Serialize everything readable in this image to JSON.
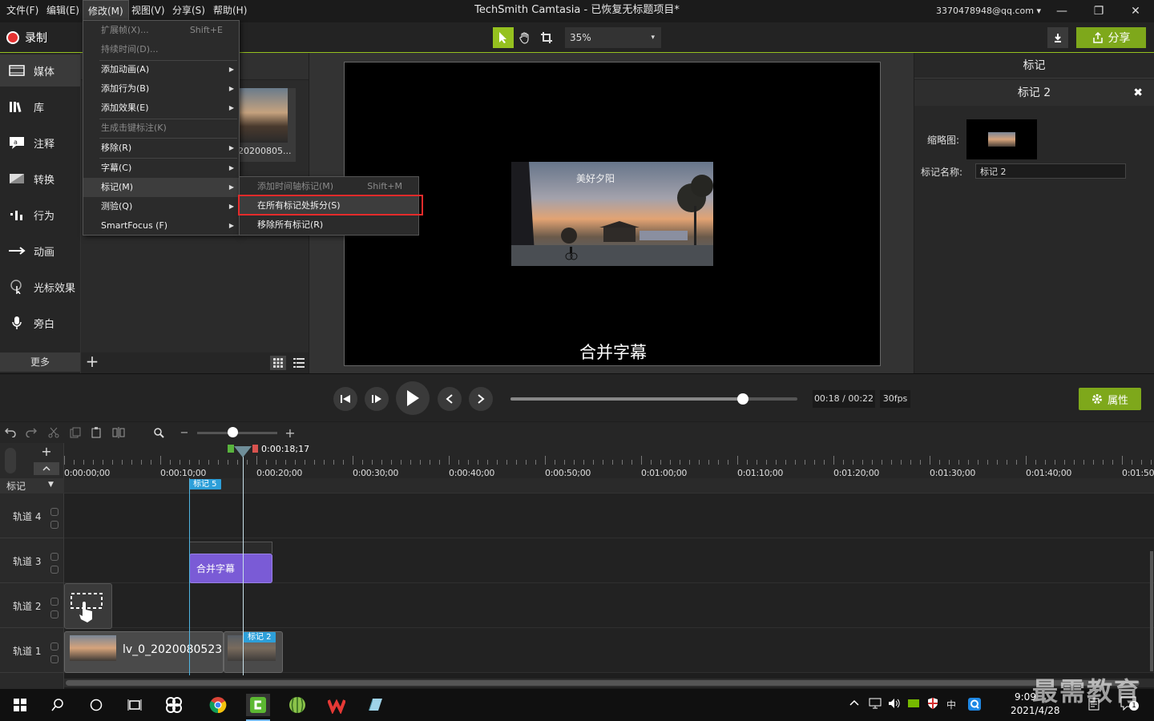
{
  "menubar": {
    "items": [
      "文件(F)",
      "编辑(E)",
      "修改(M)",
      "视图(V)",
      "分享(S)",
      "帮助(H)"
    ],
    "active_index": 2
  },
  "window": {
    "title": "TechSmith Camtasia - 已恢复无标题项目*",
    "account": "3370478948@qq.com",
    "account_caret": "▾",
    "minimize": "—",
    "restore": "❐",
    "close": "✕"
  },
  "toolbar": {
    "record_label": "录制",
    "zoom_value": "35%",
    "zoom_caret": "▾",
    "share_label": "分享"
  },
  "sidebar": {
    "items": [
      {
        "label": "媒体",
        "icon": "film-icon"
      },
      {
        "label": "库",
        "icon": "library-icon"
      },
      {
        "label": "注释",
        "icon": "annotation-icon"
      },
      {
        "label": "转换",
        "icon": "transition-icon"
      },
      {
        "label": "行为",
        "icon": "behavior-icon"
      },
      {
        "label": "动画",
        "icon": "animation-icon"
      },
      {
        "label": "光标效果",
        "icon": "cursor-effect-icon"
      },
      {
        "label": "旁白",
        "icon": "microphone-icon"
      }
    ],
    "more_label": "更多",
    "add_label": "+"
  },
  "bin": {
    "thumb_label": "20200805..."
  },
  "canvas": {
    "video_caption": "美好夕阳",
    "subtitle": "合并字幕"
  },
  "properties": {
    "title": "标记",
    "marker_name": "标记 2",
    "close": "✖",
    "thumbnail_label": "缩略图:",
    "name_label": "标记名称:",
    "name_value": "标记 2"
  },
  "playback": {
    "time": "00:18 / 00:22",
    "fps": "30fps",
    "progress": 0.81,
    "attr_label": "属性"
  },
  "timeline": {
    "playhead_time": "0:00:18;17",
    "zoom_minus": "−",
    "zoom_plus": "+",
    "zoom_level": 0.44,
    "ticks": [
      "0:00:00;00",
      "0:00:10;00",
      "0:00:20;00",
      "0:00:30;00",
      "0:00:40;00",
      "0:00:50;00",
      "0:01:00;00",
      "0:01:10;00",
      "0:01:20;00",
      "0:01:30;00",
      "0:01:40;00",
      "0:01:50;00"
    ],
    "marker_track_label": "标记",
    "markers": [
      "标记 5",
      "标记 2"
    ],
    "tracks": [
      "轨道 4",
      "轨道 3",
      "轨道 2",
      "轨道 1"
    ],
    "clip_subtitle_label": "合并字幕",
    "clip_video_label": "lv_0_2020080523"
  },
  "modify_menu": {
    "items": [
      {
        "label": "扩展帧(X)...",
        "shortcut": "Shift+E",
        "disabled": true,
        "submenu": false
      },
      {
        "label": "持续时间(D)...",
        "shortcut": "",
        "disabled": true,
        "submenu": false
      },
      {
        "label": "添加动画(A)",
        "shortcut": "",
        "disabled": false,
        "submenu": true
      },
      {
        "label": "添加行为(B)",
        "shortcut": "",
        "disabled": false,
        "submenu": true
      },
      {
        "label": "添加效果(E)",
        "shortcut": "",
        "disabled": false,
        "submenu": true
      },
      {
        "label": "生成击键标注(K)",
        "shortcut": "",
        "disabled": true,
        "submenu": false
      },
      {
        "label": "移除(R)",
        "shortcut": "",
        "disabled": false,
        "submenu": true
      },
      {
        "label": "字幕(C)",
        "shortcut": "",
        "disabled": false,
        "submenu": true
      },
      {
        "label": "标记(M)",
        "shortcut": "",
        "disabled": false,
        "submenu": true
      },
      {
        "label": "测验(Q)",
        "shortcut": "",
        "disabled": false,
        "submenu": true
      },
      {
        "label": "SmartFocus (F)",
        "shortcut": "",
        "disabled": false,
        "submenu": true
      }
    ]
  },
  "marker_submenu": {
    "items": [
      {
        "label": "添加时间轴标记(M)",
        "shortcut": "Shift+M",
        "disabled": true
      },
      {
        "label": "在所有标记处拆分(S)",
        "shortcut": "",
        "disabled": false
      },
      {
        "label": "移除所有标记(R)",
        "shortcut": "",
        "disabled": false
      }
    ]
  },
  "taskbar": {
    "time": "9:09",
    "date": "2021/4/28",
    "ime": "中",
    "notification_count": "1"
  },
  "watermark": "最需教育",
  "colors": {
    "accent_green": "#95c11f",
    "button_green": "#7ea81b",
    "marker_blue": "#2d9fd9",
    "subtitle_clip": "#7a5bd6",
    "highlight_red": "#e52b2b",
    "record_red": "#e63232"
  }
}
